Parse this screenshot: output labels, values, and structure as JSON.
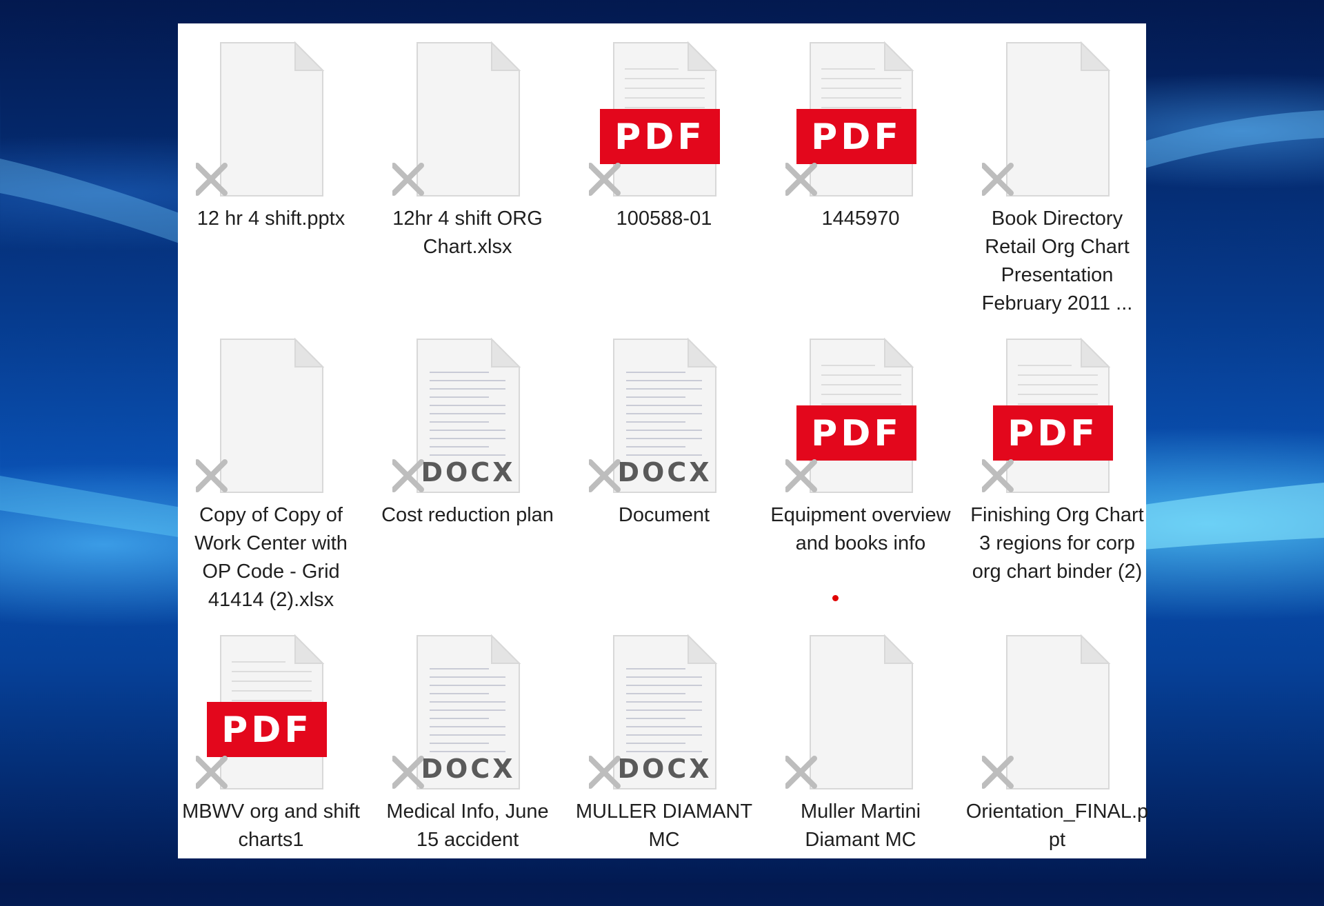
{
  "desktop": {
    "wallpaper": "blue-light-swoosh"
  },
  "files": [
    {
      "name": "12 hr 4 shift.pptx",
      "icon": "blank-file-icon",
      "status_icon": "cross-icon"
    },
    {
      "name": "12hr 4 shift ORG Chart.xlsx",
      "icon": "blank-file-icon",
      "status_icon": "cross-icon"
    },
    {
      "name": "100588-01",
      "icon": "pdf-file-icon",
      "badge": "PDF",
      "status_icon": "cross-icon"
    },
    {
      "name": "1445970",
      "icon": "pdf-file-icon",
      "badge": "PDF",
      "status_icon": "cross-icon"
    },
    {
      "name": "Book Directory Retail Org Chart Presentation February 2011 ...",
      "icon": "blank-file-icon",
      "status_icon": "cross-icon"
    },
    {
      "name": "Copy of Copy of Work Center with OP Code - Grid 41414 (2).xlsx",
      "icon": "blank-file-icon",
      "status_icon": "cross-icon"
    },
    {
      "name": "Cost reduction plan",
      "icon": "docx-file-icon",
      "badge": "DOCX",
      "status_icon": "cross-icon"
    },
    {
      "name": "Document",
      "icon": "docx-file-icon",
      "badge": "DOCX",
      "status_icon": "cross-icon"
    },
    {
      "name": "Equipment overview and books info",
      "icon": "pdf-file-icon",
      "badge": "PDF",
      "status_icon": "cross-icon"
    },
    {
      "name": "Finishing Org Chart 3 regions for corp org chart binder (2)",
      "icon": "pdf-file-icon",
      "badge": "PDF",
      "status_icon": "cross-icon"
    },
    {
      "name": "MBWV org and shift charts1",
      "icon": "pdf-file-icon",
      "badge": "PDF",
      "status_icon": "cross-icon"
    },
    {
      "name": "Medical Info, June 15 accident",
      "icon": "docx-file-icon",
      "badge": "DOCX",
      "status_icon": "cross-icon"
    },
    {
      "name": "MULLER DIAMANT MC",
      "icon": "docx-file-icon",
      "badge": "DOCX",
      "status_icon": "cross-icon"
    },
    {
      "name": "Muller Martini Diamant MC",
      "icon": "blank-file-icon",
      "status_icon": "cross-icon"
    },
    {
      "name": "Orientation_FINAL.ppt",
      "icon": "blank-file-icon",
      "status_icon": "cross-icon"
    }
  ],
  "colors": {
    "pdf_badge": "#e3071c",
    "docx_text": "#5a5a5a",
    "cross": "#bdbdbd",
    "name_text": "#1f1f1f",
    "cursor_dot": "#e00000"
  }
}
